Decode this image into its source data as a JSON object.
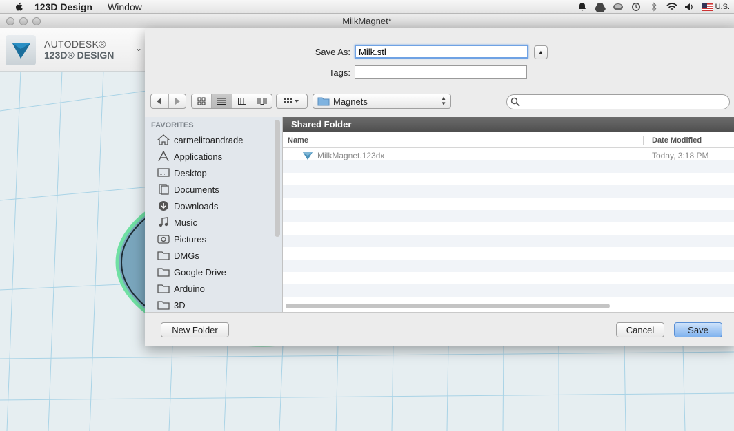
{
  "menubar": {
    "app_name": "123D Design",
    "menu_window": "Window",
    "input_source": "U.S."
  },
  "window": {
    "title": "MilkMagnet*"
  },
  "brand": {
    "line1": "AUTODESK®",
    "line2": "123D® DESIGN"
  },
  "dialog": {
    "save_as_label": "Save As:",
    "save_as_value": "Milk.stl",
    "tags_label": "Tags:",
    "tags_value": "",
    "location": "Magnets",
    "search_placeholder": ""
  },
  "sidebar": {
    "heading": "FAVORITES",
    "items": [
      {
        "label": "carmelitoandrade",
        "icon": "home-icon"
      },
      {
        "label": "Applications",
        "icon": "applications-icon"
      },
      {
        "label": "Desktop",
        "icon": "desktop-icon"
      },
      {
        "label": "Documents",
        "icon": "documents-icon"
      },
      {
        "label": "Downloads",
        "icon": "downloads-icon"
      },
      {
        "label": "Music",
        "icon": "music-icon"
      },
      {
        "label": "Pictures",
        "icon": "pictures-icon"
      },
      {
        "label": "DMGs",
        "icon": "folder-icon"
      },
      {
        "label": "Google Drive",
        "icon": "folder-icon"
      },
      {
        "label": "Arduino",
        "icon": "folder-icon"
      },
      {
        "label": "3D",
        "icon": "folder-icon"
      }
    ]
  },
  "list": {
    "section_title": "Shared Folder",
    "col_name": "Name",
    "col_date": "Date Modified",
    "files": [
      {
        "name": "MilkMagnet.123dx",
        "date": "Today, 3:18 PM"
      }
    ]
  },
  "footer": {
    "new_folder": "New Folder",
    "cancel": "Cancel",
    "save": "Save"
  }
}
